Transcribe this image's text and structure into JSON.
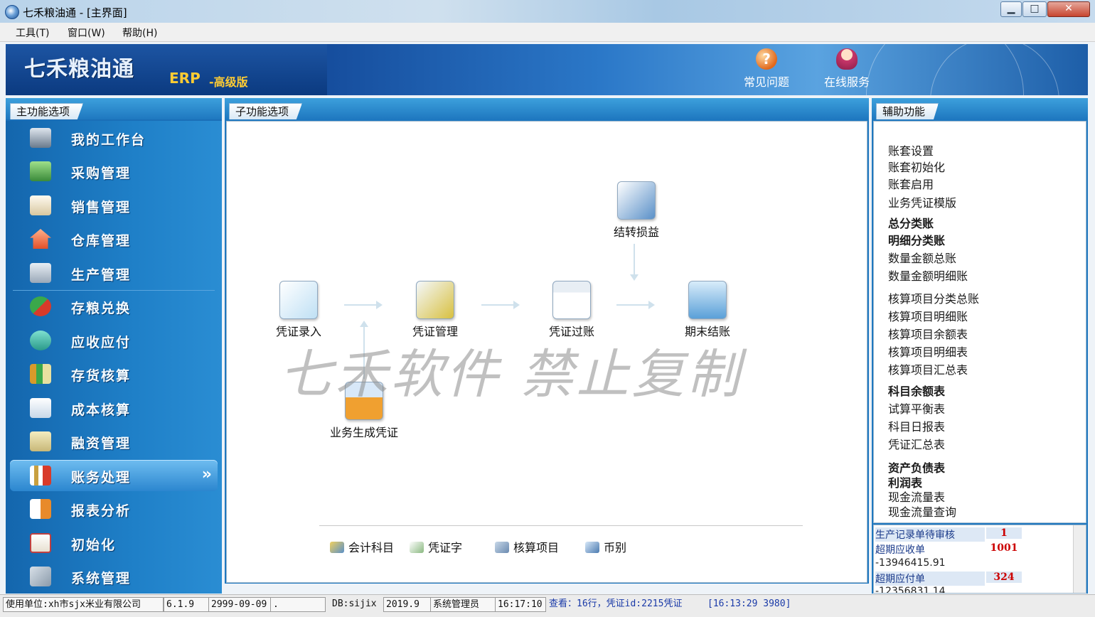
{
  "window": {
    "title": "七禾粮油通 - [主界面]",
    "controls": {
      "minimize": "▁",
      "maximize": "□",
      "close": "✕"
    }
  },
  "menu": [
    {
      "label": "工具(T)"
    },
    {
      "label": "窗口(W)"
    },
    {
      "label": "帮助(H)"
    }
  ],
  "banner": {
    "logo": "七禾粮油通",
    "erp": "ERP",
    "edition": "-高级版",
    "faq_label": "常见问题",
    "faq_icon": "question-icon",
    "service_label": "在线服务",
    "service_icon": "support-agent-icon"
  },
  "left_panel": {
    "title": "主功能选项",
    "items": [
      {
        "label": "我的工作台",
        "icon": "workbench-icon",
        "color": "#6a7a8c"
      },
      {
        "label": "采购管理",
        "icon": "truck-icon",
        "color": "#3a8a3a"
      },
      {
        "label": "销售管理",
        "icon": "invoice-icon",
        "color": "#d8c8a0"
      },
      {
        "label": "仓库管理",
        "icon": "house-icon",
        "color": "#e2502a"
      },
      {
        "label": "生产管理",
        "icon": "factory-icon",
        "color": "#9aa8b8"
      },
      {
        "label": "存粮兑换",
        "icon": "exchange-arrows-icon",
        "color": "#3aa84a"
      },
      {
        "label": "应收应付",
        "icon": "coins-icon",
        "color": "#2a9a8a"
      },
      {
        "label": "存货核算",
        "icon": "bar-chart-icon",
        "color": "#d89a2a"
      },
      {
        "label": "成本核算",
        "icon": "calculator-icon",
        "color": "#c8d8e8"
      },
      {
        "label": "融资管理",
        "icon": "money-stack-icon",
        "color": "#c8b878"
      },
      {
        "label": "账务处理",
        "icon": "ledger-chart-icon",
        "color": "#c8a040",
        "active": true
      },
      {
        "label": "报表分析",
        "icon": "report-icon",
        "color": "#e88a2a"
      },
      {
        "label": "初始化",
        "icon": "checklist-icon",
        "color": "#e8e0d0"
      },
      {
        "label": "系统管理",
        "icon": "tools-icon",
        "color": "#8a9aaa"
      }
    ],
    "active_arrow": "»"
  },
  "center_panel": {
    "title": "子功能选项",
    "nodes": {
      "voucher_entry": "凭证录入",
      "voucher_manage": "凭证管理",
      "voucher_post": "凭证过账",
      "period_close": "期末结账",
      "profit_transfer": "结转损益",
      "business_voucher": "业务生成凭证"
    },
    "watermark": "七禾软件 禁止复制",
    "bottom_links": [
      {
        "label": "会计科目",
        "icon": "accounts-icon"
      },
      {
        "label": "凭证字",
        "icon": "voucher-word-icon"
      },
      {
        "label": "核算项目",
        "icon": "accounting-item-icon"
      },
      {
        "label": "币别",
        "icon": "currency-icon"
      }
    ]
  },
  "right_panel": {
    "title": "辅助功能",
    "links": [
      {
        "label": "账套设置",
        "bold": false
      },
      {
        "label": "账套初始化",
        "bold": false
      },
      {
        "label": "账套启用",
        "bold": false
      },
      {
        "label": "业务凭证模版",
        "bold": false
      },
      {
        "label": "总分类账",
        "bold": true
      },
      {
        "label": "明细分类账",
        "bold": true
      },
      {
        "label": "数量金额总账",
        "bold": false
      },
      {
        "label": "数量金额明细账",
        "bold": false
      },
      {
        "label": "核算项目分类总账",
        "bold": false
      },
      {
        "label": "核算项目明细账",
        "bold": false
      },
      {
        "label": "核算项目余额表",
        "bold": false
      },
      {
        "label": "核算项目明细表",
        "bold": false
      },
      {
        "label": "核算项目汇总表",
        "bold": false
      },
      {
        "label": "科目余额表",
        "bold": true
      },
      {
        "label": "试算平衡表",
        "bold": false
      },
      {
        "label": "科目日报表",
        "bold": false
      },
      {
        "label": "凭证汇总表",
        "bold": false
      },
      {
        "label": "资产负债表",
        "bold": true
      },
      {
        "label": "利润表",
        "bold": true
      },
      {
        "label": "现金流量表",
        "bold": false
      },
      {
        "label": "现金流量查询",
        "bold": false
      }
    ],
    "alerts": [
      {
        "name": "生产记录单待审核",
        "count": "1",
        "amount": ""
      },
      {
        "name": "超期应收单",
        "count": "1001",
        "amount": "-13946415.91"
      },
      {
        "name": "超期应付单",
        "count": "324",
        "amount": "-12356831.14"
      }
    ]
  },
  "statusbar": {
    "unit": "使用单位:xh市sjx米业有限公司",
    "version": "6.1.9",
    "expiry": "2999-09-09",
    "blank": ".",
    "db": "DB:sijix",
    "period": "2019.9",
    "user": "系统管理员",
    "time": "16:17:10",
    "message": "查看：16行，凭证id:2215凭证",
    "log": "[16:13:29 3980]"
  }
}
